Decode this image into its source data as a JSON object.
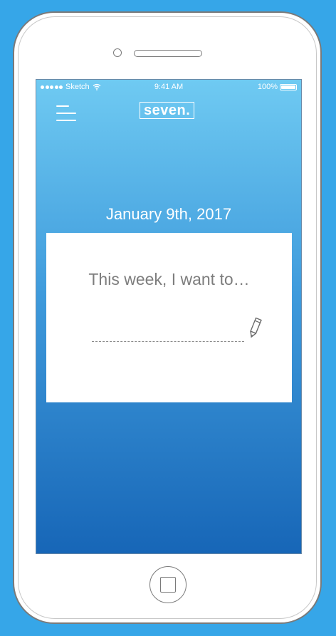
{
  "status_bar": {
    "carrier": "Sketch",
    "time": "9:41 AM",
    "battery": "100%"
  },
  "header": {
    "menu_icon": "hamburger-menu-icon",
    "logo_text": "seven."
  },
  "main": {
    "date": "January 9th, 2017",
    "prompt": "This week, I want to…",
    "goal_input": {
      "value": "",
      "placeholder": ""
    },
    "edit_icon": "pencil-icon"
  },
  "colors": {
    "page_background": "#36a6e8",
    "gradient_top": "#6fcaf2",
    "gradient_bottom": "#1766b7",
    "card": "#ffffff",
    "prompt_text": "#7d7d7d"
  }
}
